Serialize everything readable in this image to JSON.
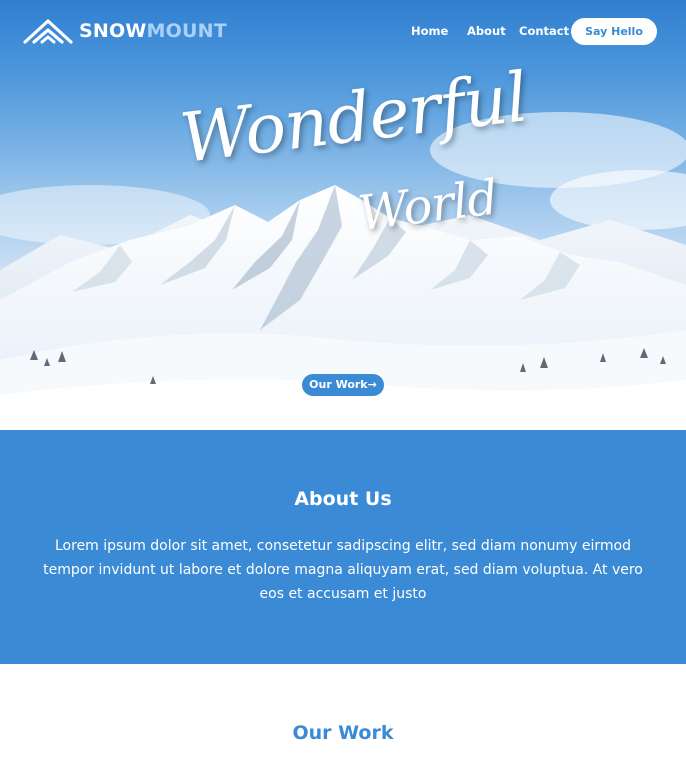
{
  "brand": {
    "name_part1": "SNOW",
    "name_part2": "MOUNT",
    "logo_icon": "mountain-icon"
  },
  "nav": {
    "items": [
      {
        "label": "Home"
      },
      {
        "label": "About"
      },
      {
        "label": "Contact"
      }
    ],
    "cta_label": "Say Hello"
  },
  "hero": {
    "title_line1": "Wonderful",
    "title_line2": "World",
    "button_label": "Our Work",
    "button_icon": "arrow-right-icon"
  },
  "about": {
    "title": "About Us",
    "text": "Lorem ipsum dolor sit amet, consetetur sadipscing elitr, sed diam nonumy eirmod tempor invidunt ut labore et dolore magna aliquyam erat, sed diam voluptua. At vero eos et accusam et justo"
  },
  "work": {
    "title": "Our Work"
  },
  "colors": {
    "accent": "#3a8ad6",
    "logo_light": "#aad0f8",
    "white": "#ffffff"
  }
}
